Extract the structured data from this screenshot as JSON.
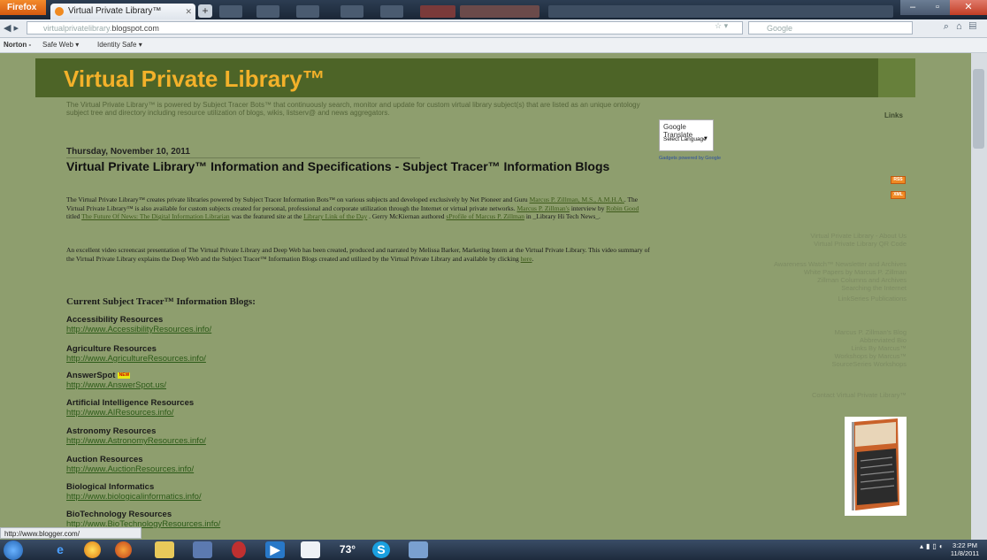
{
  "browser": {
    "app_button": "Firefox",
    "tab_title": "Virtual Private Library™",
    "new_tab": "+",
    "url_prefix": "virtualprivatelibrary.",
    "url_domain": "blogspot.com",
    "search_placeholder": "Google",
    "toolbar": {
      "norton": "Norton -",
      "safe_web": "Safe Web ▾",
      "identity_safe": "Identity Safe ▾"
    }
  },
  "blog": {
    "title": "Virtual Private Library™",
    "description": "The Virtual Private Library™ is powered by Subject Tracer Bots™ that continuously search, monitor and update for custom virtual library subject(s) that are listed as an unique ontology subject tree and directory including resource utilization of blogs, wikis, listserv@ and news aggregators.",
    "date": "Thursday, November 10, 2011",
    "post_title": "Virtual Private Library™ Information and Specifications - Subject Tracer™ Information Blogs",
    "para1": {
      "t1": "The Virtual Private Library™ creates private libraries powered by Subject Tracer Information Bots™ on various subjects and developed exclusively by Net Pioneer and Guru ",
      "l1": "Marcus P. Zillman, M.S., A.M.H.A.",
      "t2": ". The Virtual Private Library™ is also available for custom subjects created for personal, professional and corporate utilization through the Internet or virtual private networks. ",
      "l2": "Marcus P. Zillman's",
      "t3": " interview by ",
      "l3": "Robin Good",
      "t4": " titled ",
      "l4": "The Future Of News: The Digital Information Librarian",
      "t5": " was the featured site at the ",
      "l5": "Library Link of the Day",
      "t6": " . Gerry McKiernan authored ",
      "l6": "sProfile of Marcus P. Zillman",
      "t7": " in _Library Hi Tech News_."
    },
    "para2": {
      "t1": "An excellent video screencast presentation of The Virtual Private Library and Deep Web has been created, produced and narrated by Melissa Barker, Marketing Intern at the Virtual Private Library. This video summary of the Virtual Private Library explains the Deep Web and the Subject Tracer™ Information Blogs created and utilized by the Virtual Private Library and available by clicking ",
      "l1": "here",
      "t2": "."
    },
    "current_heading": "Current Subject Tracer™ Information Blogs:",
    "new_badge": "NEW",
    "entries": [
      {
        "name": "Accessibility Resources",
        "url": "http://www.AccessibilityResources.info/"
      },
      {
        "name": "Agriculture Resources",
        "url": "http://www.AgricultureResources.info/"
      },
      {
        "name": "AnswerSpot",
        "url": "http://www.AnswerSpot.us/"
      },
      {
        "name": "Artificial Intelligence Resources",
        "url": "http://www.AIResources.info/"
      },
      {
        "name": "Astronomy Resources",
        "url": "http://www.AstronomyResources.info/"
      },
      {
        "name": "Auction Resources",
        "url": "http://www.AuctionResources.info/"
      },
      {
        "name": "Biological Informatics",
        "url": "http://www.biologicalinformatics.info/"
      },
      {
        "name": "BioTechnology Resources",
        "url": "http://www.BioTechnologyResources.info/"
      }
    ]
  },
  "sidebar": {
    "translate_brand": "Google Translate",
    "translate_select": "Select Language",
    "translate_powered": "Gadgets powered by Google",
    "links_heading": "Links",
    "rss": "RSS",
    "xml": "XML",
    "links": [
      "Virtual Private Library - About Us",
      "Virtual Private Library QR Code",
      "Awareness Watch™ Newsletter and Archives",
      "White Papers by Marcus P. Zillman",
      "Zillman Columns and Archives",
      "Searching the Internet",
      "LinkSeries Publications",
      "Marcus P. Zillman's Blog",
      "Abbreviated Bio",
      "Links By Marcus™",
      "Workshops by Marcus™",
      "SourceSeries Workshops",
      "Contact Virtual Private Library™"
    ]
  },
  "status_text": "http://www.blogger.com/",
  "taskbar": {
    "weather": "73°",
    "time": "3:22 PM",
    "date": "11/8/2011"
  }
}
